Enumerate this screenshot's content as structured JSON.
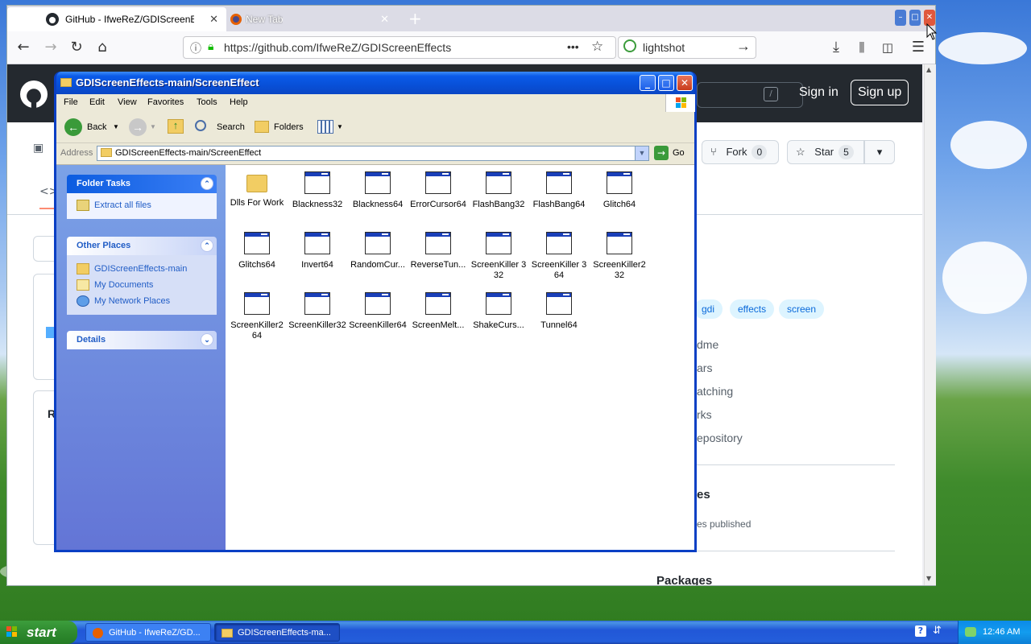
{
  "browser": {
    "tabs": [
      {
        "title": "GitHub - IfweReZ/GDIScreenEffects",
        "active": true
      },
      {
        "title": "New Tab",
        "active": false
      }
    ],
    "new_tab": "+",
    "url": "https://github.com/IfweReZ/GDIScreenEffects",
    "search_value": "lightshot",
    "page_actions": "•••"
  },
  "github": {
    "signin": "Sign in",
    "signup": "Sign up",
    "search_shortcut": "/",
    "fork_label": "Fork",
    "fork_count": "0",
    "star_label": "Star",
    "star_count": "5",
    "topics": [
      "gdi",
      "effects",
      "screen"
    ],
    "about_items": [
      "dme",
      "ars",
      "atching",
      "rks",
      "epository"
    ],
    "releases_title": "es",
    "releases_text": "es published",
    "packages_title": "Packages",
    "left_letter": "R"
  },
  "explorer": {
    "title": "GDIScreenEffects-main/ScreenEffect",
    "menu": [
      "File",
      "Edit",
      "View",
      "Favorites",
      "Tools",
      "Help"
    ],
    "toolbar": {
      "back": "Back",
      "search": "Search",
      "folders": "Folders"
    },
    "address_label": "Address",
    "address_value": "GDIScreenEffects-main/ScreenEffect",
    "go": "Go",
    "folder_tasks": {
      "title": "Folder Tasks",
      "items": [
        "Extract all files"
      ]
    },
    "other_places": {
      "title": "Other Places",
      "items": [
        "GDIScreenEffects-main",
        "My Documents",
        "My Network Places"
      ]
    },
    "details": {
      "title": "Details"
    },
    "files": [
      {
        "name": "Dlls For Work",
        "type": "folder"
      },
      {
        "name": "Blackness32",
        "type": "app"
      },
      {
        "name": "Blackness64",
        "type": "app"
      },
      {
        "name": "ErrorCursor64",
        "type": "app"
      },
      {
        "name": "FlashBang32",
        "type": "app"
      },
      {
        "name": "FlashBang64",
        "type": "app"
      },
      {
        "name": "Glitch64",
        "type": "app"
      },
      {
        "name": "Glitchs64",
        "type": "app"
      },
      {
        "name": "Invert64",
        "type": "app"
      },
      {
        "name": "RandomCur...",
        "type": "app"
      },
      {
        "name": "ReverseTun...",
        "type": "app"
      },
      {
        "name": "ScreenKiller 3\n32",
        "type": "app"
      },
      {
        "name": "ScreenKiller 3\n64",
        "type": "app"
      },
      {
        "name": "ScreenKiller2\n32",
        "type": "app"
      },
      {
        "name": "ScreenKiller2\n64",
        "type": "app"
      },
      {
        "name": "ScreenKiller32",
        "type": "app"
      },
      {
        "name": "ScreenKiller64",
        "type": "app"
      },
      {
        "name": "ScreenMelt...",
        "type": "app"
      },
      {
        "name": "ShakeCurs...",
        "type": "app"
      },
      {
        "name": "Tunnel64",
        "type": "app"
      }
    ]
  },
  "taskbar": {
    "start": "start",
    "tasks": [
      "GitHub - IfweReZ/GD...",
      "GDIScreenEffects-ma..."
    ],
    "clock": "12:46 AM"
  }
}
